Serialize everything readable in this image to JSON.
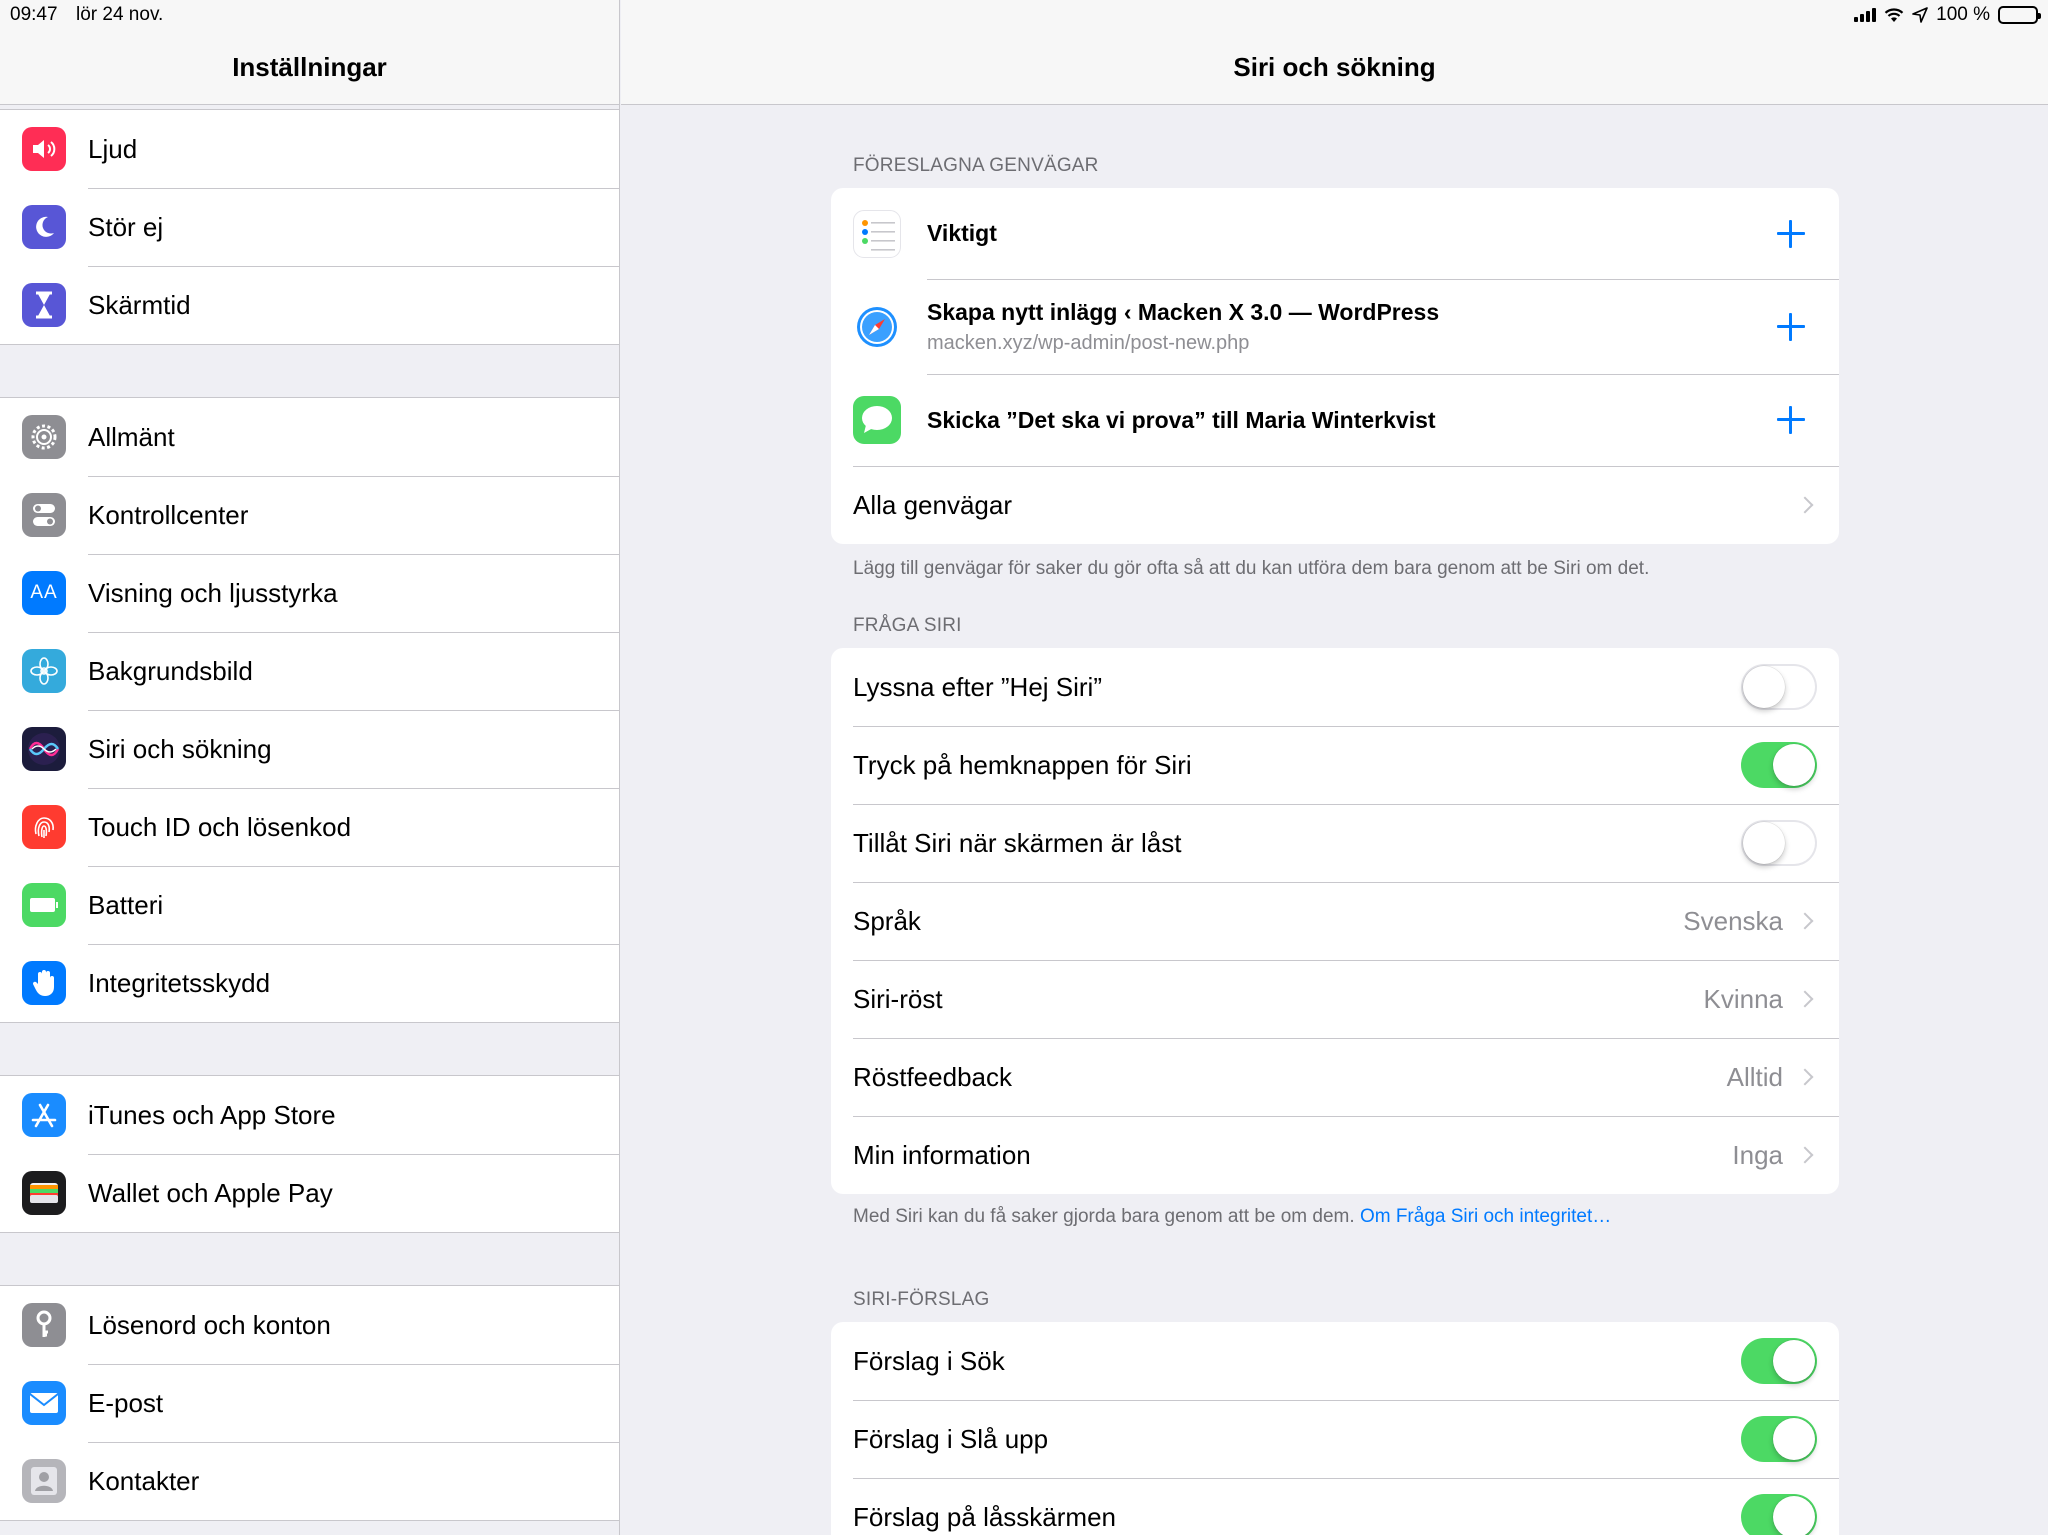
{
  "status": {
    "time": "09:47",
    "date": "lör 24 nov.",
    "battery": "100 %",
    "battery_level": 1.0
  },
  "sidebar": {
    "title": "Inställningar",
    "groups": [
      [
        {
          "label": "Ljud",
          "icon": "speaker-icon",
          "color": "#ff2d55"
        },
        {
          "label": "Stör ej",
          "icon": "moon-icon",
          "color": "#5856d6"
        },
        {
          "label": "Skärmtid",
          "icon": "hourglass-icon",
          "color": "#5856d6"
        }
      ],
      [
        {
          "label": "Allmänt",
          "icon": "gear-icon",
          "color": "#8e8e93"
        },
        {
          "label": "Kontrollcenter",
          "icon": "switches-icon",
          "color": "#8e8e93"
        },
        {
          "label": "Visning och ljusstyrka",
          "icon": "text-size-icon",
          "color": "#007aff"
        },
        {
          "label": "Bakgrundsbild",
          "icon": "flower-icon",
          "color": "#34aadc"
        },
        {
          "label": "Siri och sökning",
          "icon": "siri-icon",
          "color": "#1c1c3c"
        },
        {
          "label": "Touch ID och lösenkod",
          "icon": "fingerprint-icon",
          "color": "#ff3b30"
        },
        {
          "label": "Batteri",
          "icon": "battery-icon",
          "color": "#4cd964"
        },
        {
          "label": "Integritetsskydd",
          "icon": "hand-icon",
          "color": "#007aff"
        }
      ],
      [
        {
          "label": "iTunes och App Store",
          "icon": "app-store-icon",
          "color": "#1a8cff"
        },
        {
          "label": "Wallet och Apple Pay",
          "icon": "wallet-icon",
          "color": "#1c1c1e"
        }
      ],
      [
        {
          "label": "Lösenord och konton",
          "icon": "key-icon",
          "color": "#8e8e93"
        },
        {
          "label": "E-post",
          "icon": "mail-icon",
          "color": "#1a8cff"
        },
        {
          "label": "Kontakter",
          "icon": "contacts-icon",
          "color": "#b5b5ba"
        }
      ]
    ]
  },
  "detail": {
    "title": "Siri och sökning",
    "shortcuts": {
      "header": "FÖRESLAGNA GENVÄGAR",
      "items": [
        {
          "title": "Viktigt",
          "subtitle": "",
          "icon": "reminders-icon"
        },
        {
          "title": "Skapa nytt inlägg ‹ Macken X 3.0 — WordPress",
          "subtitle": "macken.xyz/wp-admin/post-new.php",
          "icon": "safari-icon"
        },
        {
          "title": "Skicka ”Det ska vi prova” till Maria Winterkvist",
          "subtitle": "",
          "icon": "messages-icon"
        }
      ],
      "all_label": "Alla genvägar",
      "footer": "Lägg till genvägar för saker du gör ofta så att du kan utföra dem bara genom att be Siri om det."
    },
    "ask_siri": {
      "header": "FRÅGA SIRI",
      "hey_siri": {
        "label": "Lyssna efter ”Hej Siri”",
        "on": false
      },
      "home_button": {
        "label": "Tryck på hemknappen för Siri",
        "on": true
      },
      "locked": {
        "label": "Tillåt Siri när skärmen är låst",
        "on": false
      },
      "language": {
        "label": "Språk",
        "value": "Svenska"
      },
      "voice": {
        "label": "Siri-röst",
        "value": "Kvinna"
      },
      "feedback": {
        "label": "Röstfeedback",
        "value": "Alltid"
      },
      "my_info": {
        "label": "Min information",
        "value": "Inga"
      },
      "footer_text": "Med Siri kan du få saker gjorda bara genom att be om dem. ",
      "footer_link": "Om Fråga Siri och integritet…"
    },
    "suggestions": {
      "header": "SIRI-FÖRSLAG",
      "search": {
        "label": "Förslag i Sök",
        "on": true
      },
      "lookup": {
        "label": "Förslag i Slå upp",
        "on": true
      },
      "lockscreen": {
        "label": "Förslag på låsskärmen",
        "on": true
      }
    }
  }
}
